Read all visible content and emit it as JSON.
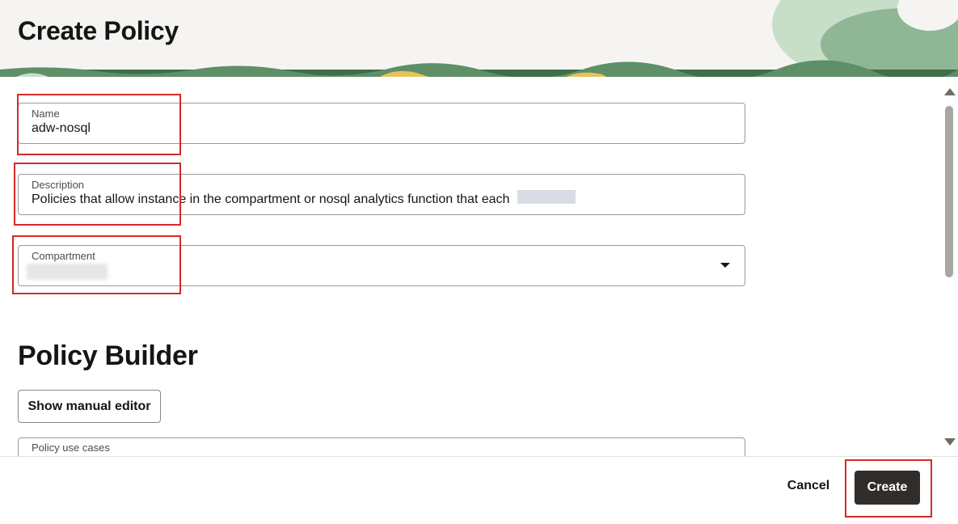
{
  "page_title": "Create Policy",
  "form": {
    "name": {
      "label": "Name",
      "value": "adw-nosql"
    },
    "description": {
      "label": "Description",
      "value": "Policies that allow instance in the compartment or nosql analytics function that each"
    },
    "compartment": {
      "label": "Compartment",
      "value": ""
    }
  },
  "policy_builder": {
    "title": "Policy Builder",
    "show_manual_editor_label": "Show manual editor",
    "use_cases": {
      "label": "Policy use cases"
    }
  },
  "footer": {
    "cancel_label": "Cancel",
    "create_label": "Create"
  },
  "colors": {
    "primary_button": "#312d2a",
    "highlight_box": "#d42a2a",
    "header_bg": "#f5f4f2",
    "decor_green": "#7aa882"
  },
  "icons": [
    "dropdown-chevron-icon",
    "scroll-up-arrow-icon",
    "scroll-down-arrow-icon"
  ]
}
